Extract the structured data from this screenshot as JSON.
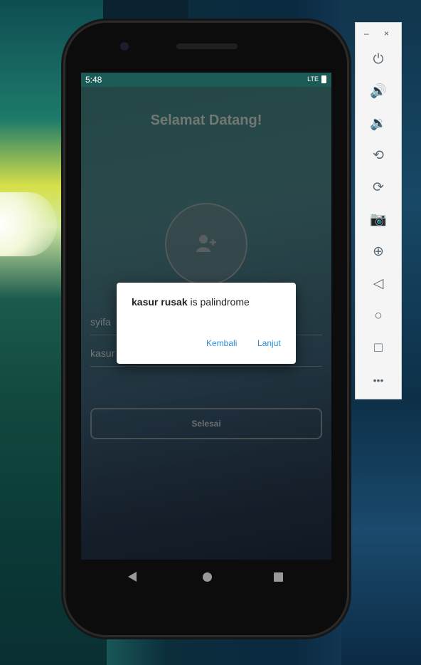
{
  "device": {
    "status_bar": {
      "time": "5:48",
      "network": "LTE"
    }
  },
  "app": {
    "title": "Selamat Datang!",
    "name_field": {
      "value": "syifa"
    },
    "palindrome_field": {
      "value": "kasur"
    },
    "finish_button": "Selesai"
  },
  "dialog": {
    "message_bold": "kasur rusak",
    "message_rest": " is palindrome",
    "buttons": {
      "back": "Kembali",
      "next": "Lanjut"
    }
  },
  "emulator_toolbar": {
    "window_controls": {
      "minimize": "–",
      "close": "×"
    },
    "tools": [
      {
        "name": "power-icon",
        "glyph": "⏻"
      },
      {
        "name": "volume-up-icon",
        "glyph": "🔊"
      },
      {
        "name": "volume-down-icon",
        "glyph": "🔉"
      },
      {
        "name": "rotate-left-icon",
        "glyph": "⟲"
      },
      {
        "name": "rotate-right-icon",
        "glyph": "⟳"
      },
      {
        "name": "camera-icon",
        "glyph": "📷"
      },
      {
        "name": "zoom-icon",
        "glyph": "⊕"
      },
      {
        "name": "back-icon",
        "glyph": "◁"
      },
      {
        "name": "home-icon",
        "glyph": "○"
      },
      {
        "name": "overview-icon",
        "glyph": "□"
      },
      {
        "name": "more-icon",
        "glyph": "•••"
      }
    ]
  },
  "colors": {
    "dialog_button": "#2a8fd8",
    "dialog_bg": "#ffffff"
  }
}
